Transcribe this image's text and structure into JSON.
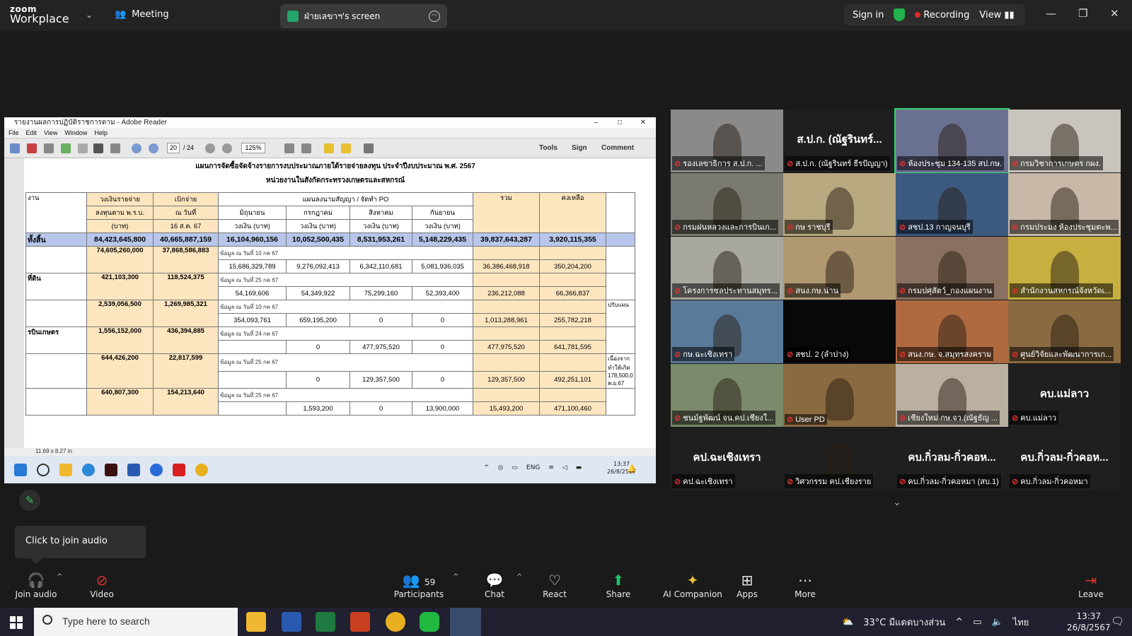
{
  "topbar": {
    "logo_line1": "zoom",
    "logo_line2": "Workplace",
    "meeting_label": "Meeting",
    "share_label": "ฝ่ายเลขาฯ's screen",
    "sign_in": "Sign in",
    "recording": "Recording",
    "view": "View"
  },
  "reader": {
    "title": "รายงานผลการปฏิบัติราชการตาม - Adobe Reader",
    "menu": [
      "File",
      "Edit",
      "View",
      "Window",
      "Help"
    ],
    "page": "20",
    "page_total": "/ 24",
    "zoom": "125%",
    "tools": "Tools",
    "sign": "Sign",
    "comment": "Comment",
    "doc_title1": "แผนการจัดซื้อจัดจ้างรายการงบประมาณภายใต้รายจ่ายลงทุน ประจำปีงบประมาณ พ.ศ. 2567",
    "doc_title2": "หน่วยงานในสังกัดกระทรวงเกษตรและสหกรณ์",
    "headers": {
      "unit": "งาน",
      "budget": "วงเงินรายจ่าย",
      "budget2": "ลงทุนตาม พ.ร.บ.",
      "budget3": "(บาท)",
      "paid": "เบิกจ่าย",
      "paid2": "ณ วันที่",
      "paid3": "16 ส.ค. 67",
      "plan": "แผนลงนามสัญญา / จัดทำ PO",
      "total": "รวม",
      "remain": "คงเหลือ",
      "m1": "มิถุนายน",
      "m2": "กรกฎาคม",
      "m3": "สิงหาคม",
      "m4": "กันยายน",
      "amt": "วงเงิน (บาท)"
    },
    "total_row": {
      "label": "ทั้งสิ้น",
      "budget": "84,423,645,800",
      "paid": "40,665,887,159",
      "m1": "16,104,960,156",
      "m2": "10,052,500,435",
      "m3": "8,531,953,261",
      "m4": "5,148,229,435",
      "total": "39,837,643,287",
      "remain": "3,920,115,355"
    },
    "rows": [
      {
        "label": "",
        "budget": "74,605,260,000",
        "paid": "37,868,586,883",
        "note": "ข้อมูล ณ วันที่ 10 กค 67",
        "m1": "15,686,329,789",
        "m2": "9,276,092,413",
        "m3": "6,342,110,681",
        "m4": "5,081,936,035",
        "total": "36,386,468,918",
        "remain": "350,204,200",
        "extra": ""
      },
      {
        "label": "ที่ดิน",
        "budget": "421,103,300",
        "paid": "118,524,375",
        "note": "ข้อมูล ณ วันที่ 25 กค 67",
        "m1": "54,169,606",
        "m2": "54,349,922",
        "m3": "75,299,160",
        "m4": "52,393,400",
        "total": "236,212,088",
        "remain": "66,366,837",
        "extra": ""
      },
      {
        "label": "",
        "budget": "2,539,056,500",
        "paid": "1,269,985,321",
        "note": "ข้อมูล ณ วันที่ 10 กค 67",
        "m1": "354,093,761",
        "m2": "659,195,200",
        "m3": "0",
        "m4": "0",
        "total": "1,013,288,961",
        "remain": "255,782,218",
        "extra": "ปรับแผน"
      },
      {
        "label": "รบินเกษตร",
        "budget": "1,556,152,000",
        "paid": "436,394,885",
        "note": "ข้อมูล ณ วันที่ 24 กค 67",
        "m1": "",
        "m2": "0",
        "m3": "477,975,520",
        "m4": "0",
        "total": "477,975,520",
        "remain": "641,781,595",
        "extra": ""
      },
      {
        "label": "",
        "budget": "644,426,200",
        "paid": "22,817,599",
        "note": "ข้อมูล ณ วันที่ 25 กค 67",
        "m1": "",
        "m2": "0",
        "m3": "129,357,500",
        "m4": "0",
        "total": "129,357,500",
        "remain": "492,251,101",
        "extra": "เนื่องจาก ทำให้เกิด 178,500,0 พ.ย.67"
      },
      {
        "label": "",
        "budget": "640,807,300",
        "paid": "154,213,640",
        "note": "ข้อมูล ณ วันที่ 25 กค 67",
        "m1": "",
        "m2": "1,593,200",
        "m3": "0",
        "m4": "13,900,000",
        "total": "15,493,200",
        "remain": "471,100,460",
        "extra": ""
      }
    ],
    "status_size": "11.69 x 8.27 in",
    "tray_lang": "ENG",
    "clock_time": "13:37",
    "clock_date": "26/8/2567"
  },
  "tiles": [
    {
      "label": "รองเลขาธิการ ส.ป.ก. ...",
      "big": "",
      "bg": "#8a8a8a"
    },
    {
      "label": "ส.ป.ก. (ณัฐรินทร์ ธีรปัญญา)",
      "big": "ส.ป.ก. (ณัฐรินทร์...",
      "bg": "#1f1f1f"
    },
    {
      "label": "ห้องประชุม 134-135 สป.กษ.",
      "big": "",
      "bg": "#6a7090"
    },
    {
      "label": "กรมวิชาการเกษตร กผง.",
      "big": "",
      "bg": "#c9c4bd"
    },
    {
      "label": "กรมฝนหลวงและการบินเก...",
      "big": "",
      "bg": "#7a7a70"
    },
    {
      "label": "กษ ราชบุรี",
      "big": "",
      "bg": "#b8a880"
    },
    {
      "label": "สชป.13 กาญจนบุรี",
      "big": "",
      "bg": "#3c5a80"
    },
    {
      "label": "กรมประมง ห้องประชุมตะพ...",
      "big": "",
      "bg": "#c8b8a8"
    },
    {
      "label": "โครงการชลประทานสมุทร...",
      "big": "",
      "bg": "#a8a8a0"
    },
    {
      "label": "สนง.กษ.น่าน",
      "big": "",
      "bg": "#b09870"
    },
    {
      "label": "กรมปศุสัตว์_กองแผนงาน",
      "big": "",
      "bg": "#8a7060"
    },
    {
      "label": "สำนักงานสหกรณ์จังหวัดเ...",
      "big": "",
      "bg": "#c8b040"
    },
    {
      "label": "กษ.ฉะเชิงเทรา",
      "big": "",
      "bg": "#5a7a9a"
    },
    {
      "label": "สชป. 2 (ลำปาง)",
      "big": "",
      "bg": "#080808"
    },
    {
      "label": "สนง.กษ. จ.สมุทรสงคราม",
      "big": "",
      "bg": "#b06a40"
    },
    {
      "label": "ศูนย์วิจัยและพัฒนาการเก...",
      "big": "",
      "bg": "#8a6a40"
    },
    {
      "label": "ชนม์ฐพัฒน์ จน.คป.เชียงใ...",
      "big": "",
      "bg": "#7a8a6a"
    },
    {
      "label": "User PD",
      "big": "",
      "bg": "#8a6a40"
    },
    {
      "label": "เชียงใหม่ กษ.จว.(ณัฐธัญ ...",
      "big": "",
      "bg": "#bab0a0"
    },
    {
      "label": "คบ.แม่ลาว",
      "big": "คบ.แม่ลาว",
      "bg": "#1f1f1f"
    },
    {
      "label": "คป.ฉะเชิงเทรา",
      "big": "คป.ฉะเชิงเทรา",
      "bg": "#1f1f1f"
    },
    {
      "label": "วิศวกรรม คป.เชียงราย",
      "big": "",
      "bg": "#1f1f1f"
    },
    {
      "label": "คบ.กิ่วลม-กิ่วคอหมา (สบ.1)",
      "big": "คบ.กิ่วลม-กิ่วคอห...",
      "bg": "#1f1f1f"
    },
    {
      "label": "คบ.กิ่วลม-กิ่วคอหมา",
      "big": "คบ.กิ่วลม-กิ่วคอห...",
      "bg": "#1f1f1f"
    }
  ],
  "tooltip": "Click to join audio",
  "controls": {
    "join_audio": "Join audio",
    "video": "Video",
    "participants": "Participants",
    "participant_count": "59",
    "chat": "Chat",
    "react": "React",
    "share": "Share",
    "ai": "AI Companion",
    "apps": "Apps",
    "more": "More",
    "leave": "Leave"
  },
  "taskbar": {
    "search": "Type here to search",
    "weather": "33°C มีแดดบางส่วน",
    "lang": "ไทย",
    "time": "13:37",
    "date": "26/8/2567"
  },
  "colors": {
    "zoom_green": "#24a46b",
    "recording_red": "#e02828",
    "table_yellow": "#fde6bf",
    "table_blue": "#b7c6ea"
  }
}
